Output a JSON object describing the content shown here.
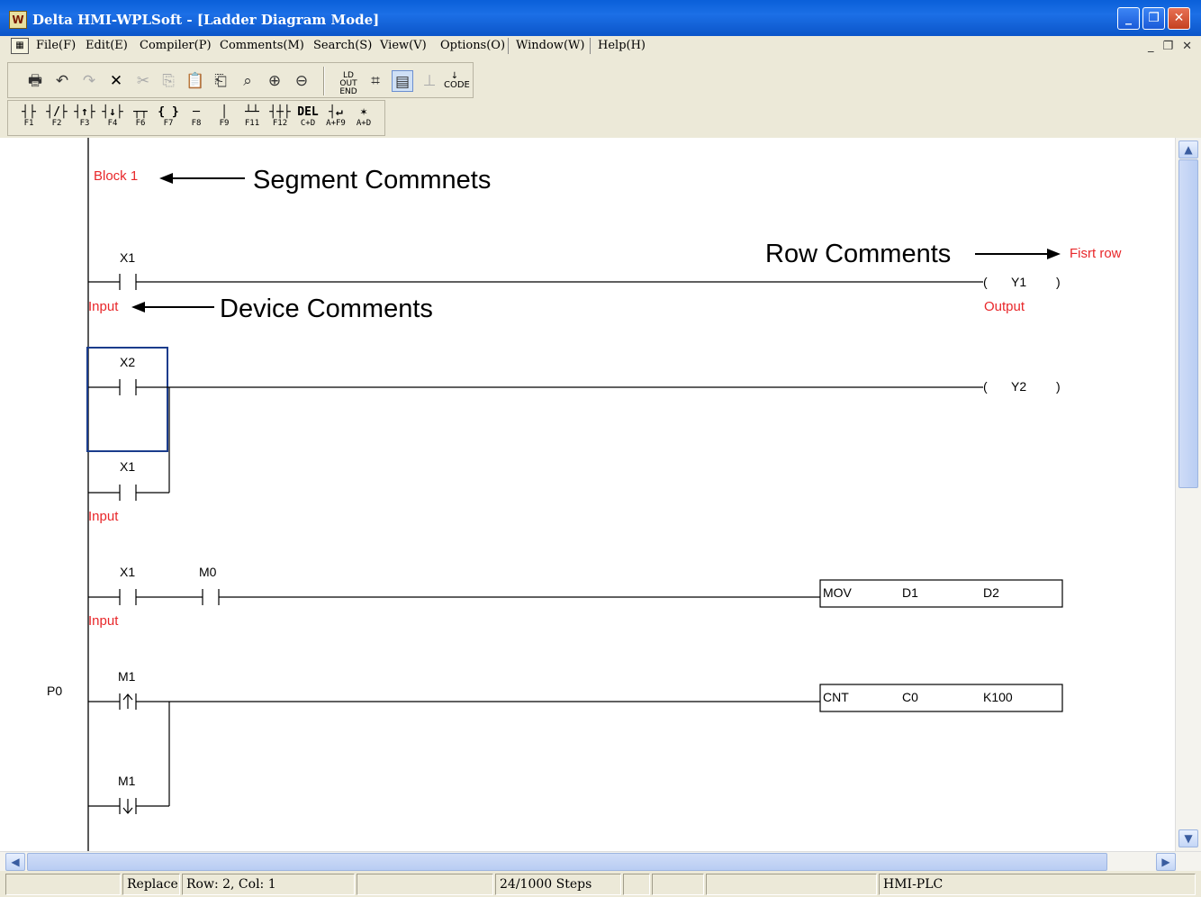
{
  "window": {
    "title": "Delta HMI-WPLSoft - [Ladder Diagram Mode]"
  },
  "menu": [
    "File(F)",
    "Edit(E)",
    "Compiler(P)",
    "Comments(M)",
    "Search(S)",
    "View(V)",
    "Options(O)",
    "Window(W)",
    "Help(H)"
  ],
  "fkeys": [
    {
      "sym": "┤├",
      "label": "F1"
    },
    {
      "sym": "┤/├",
      "label": "F2"
    },
    {
      "sym": "┤↑├",
      "label": "F3"
    },
    {
      "sym": "┤↓├",
      "label": "F4"
    },
    {
      "sym": "┬┬",
      "label": "F6"
    },
    {
      "sym": "{ }",
      "label": "F7"
    },
    {
      "sym": "─",
      "label": "F8"
    },
    {
      "sym": "│",
      "label": "F9"
    },
    {
      "sym": "┴┴",
      "label": "F11"
    },
    {
      "sym": "┤┼├",
      "label": "F12"
    },
    {
      "sym": "DEL",
      "label": "C+D"
    },
    {
      "sym": "┤↵",
      "label": "A+F9"
    },
    {
      "sym": "✶",
      "label": "A+D"
    }
  ],
  "ladder": {
    "segment_comment": "Block 1",
    "pointer_label": "P0",
    "rows": [
      {
        "contacts": [
          "X1"
        ],
        "coil": "Y1",
        "device_comment": "Input",
        "coil_comment": "Output",
        "row_comment": "Fisrt row"
      },
      {
        "contacts": [
          "X2",
          "X1"
        ],
        "coil": "Y2",
        "device_comment": "Input"
      },
      {
        "contacts": [
          "X1",
          "M0"
        ],
        "instruction": {
          "op": "MOV",
          "arg1": "D1",
          "arg2": "D2"
        },
        "device_comment": "Input"
      },
      {
        "contacts": [
          "M1",
          "M1"
        ],
        "instruction": {
          "op": "CNT",
          "arg1": "C0",
          "arg2": "K100"
        }
      }
    ]
  },
  "annotations": {
    "segment": "Segment Commnets",
    "row": "Row Comments",
    "device": "Device Comments"
  },
  "coil_paren_open": "(",
  "coil_paren_close": ")",
  "status": {
    "mode": "Replace",
    "position": "Row: 2, Col: 1",
    "steps": "24/1000 Steps",
    "device": "HMI-PLC"
  }
}
